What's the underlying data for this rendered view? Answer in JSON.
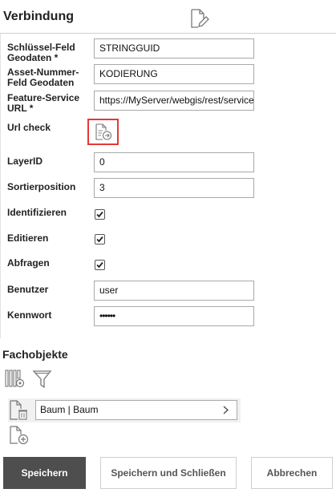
{
  "header": {
    "title": "Verbindung"
  },
  "form": {
    "key_field_label": "Schlüssel-Feld Geodaten *",
    "key_field_value": "STRINGGUID",
    "asset_field_label": "Asset-Nummer-Feld Geodaten",
    "asset_field_value": "KODIERUNG",
    "service_url_label": "Feature-Service URL *",
    "service_url_value": "https://MyServer/webgis/rest/services",
    "url_check_label": "Url check",
    "layerid_label": "LayerID",
    "layerid_value": "0",
    "sort_label": "Sortierposition",
    "sort_value": "3",
    "identify_label": "Identifizieren",
    "identify_checked": true,
    "edit_label": "Editieren",
    "edit_checked": true,
    "query_label": "Abfragen",
    "query_checked": true,
    "user_label": "Benutzer",
    "user_value": "user",
    "password_label": "Kennwort",
    "password_value": "••••••"
  },
  "fachobjekte": {
    "title": "Fachobjekte",
    "items": [
      {
        "label": "Baum | Baum"
      }
    ]
  },
  "buttons": {
    "save": "Speichern",
    "save_close": "Speichern und Schließen",
    "cancel": "Abbrechen"
  },
  "icons": {
    "edit": "document-edit-icon",
    "url_check": "document-check-icon",
    "columns_settings": "columns-settings-icon",
    "filter": "filter-icon",
    "delete_doc": "document-delete-icon",
    "add_doc": "document-add-icon",
    "chevron": "chevron-right-icon"
  },
  "colors": {
    "highlight": "#e53935",
    "primary_button": "#4e4e4e"
  }
}
